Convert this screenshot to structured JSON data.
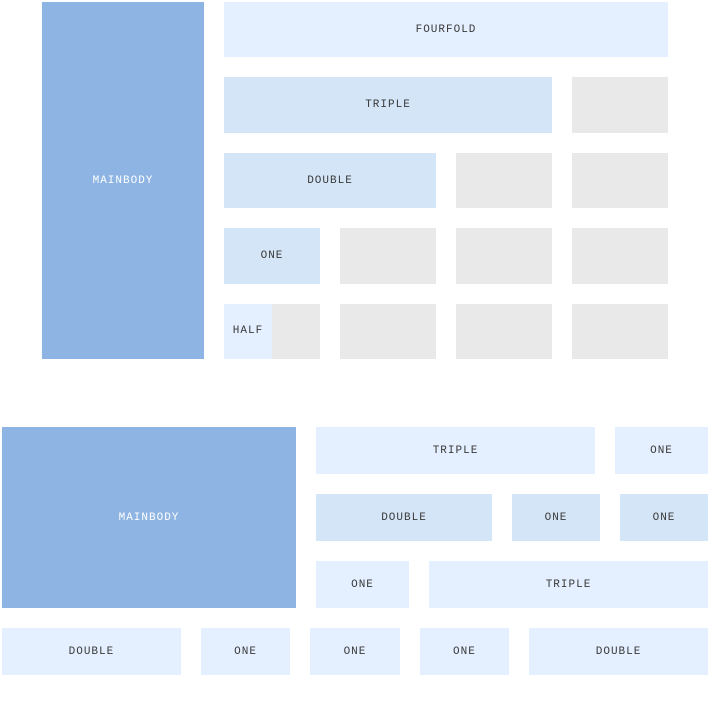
{
  "labels": {
    "mainbody": "MAINBODY",
    "fourfold": "FOURFOLD",
    "triple": "TRIPLE",
    "double": "DOUBLE",
    "one": "ONE",
    "half": "HALF"
  },
  "colors": {
    "main": "#8db4e2",
    "light": "#e4efff",
    "mid": "#d4e5f7",
    "grey": "#e9e9e9"
  }
}
